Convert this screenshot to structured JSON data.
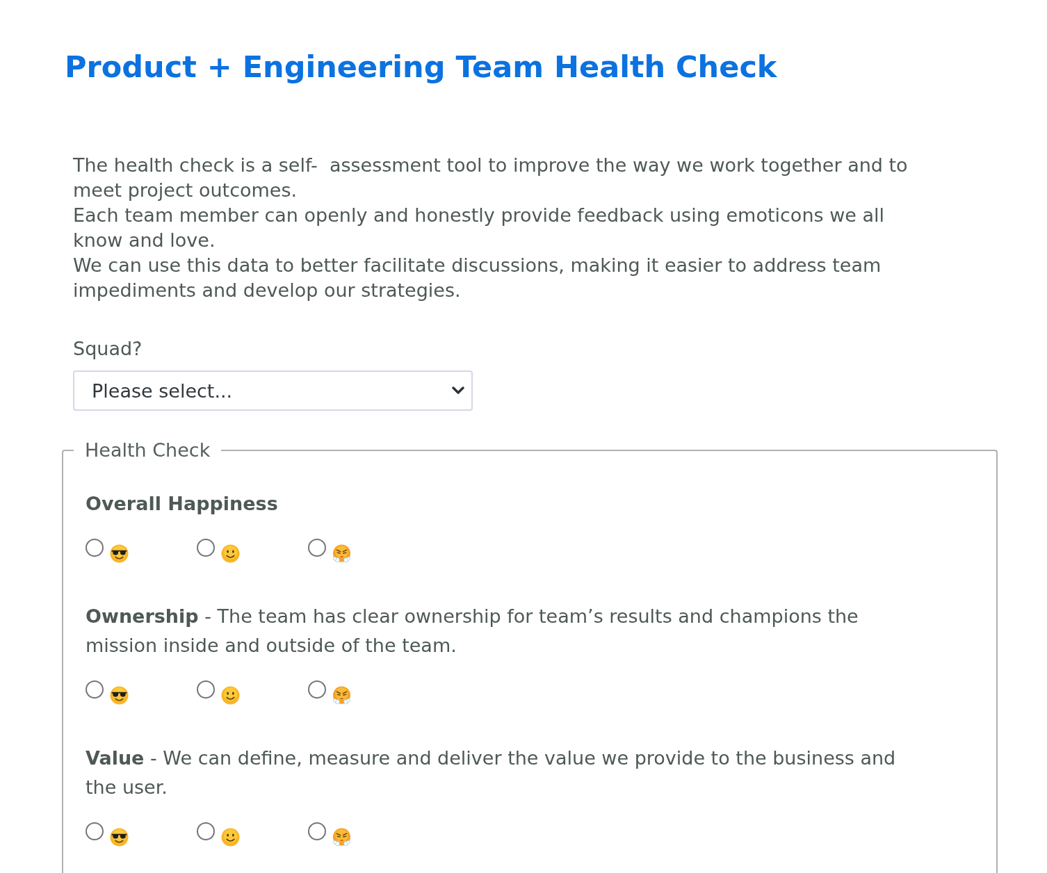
{
  "title": "Product + Engineering Team Health Check",
  "intro": [
    "The health check is a self-  assessment tool to improve the way we work together and to meet project outcomes.",
    "Each team member can openly and honestly provide feedback using emoticons we all know and love.",
    "We can use this data to better facilitate discussions, making it easier to address team impediments and develop our strategies."
  ],
  "squad": {
    "label": "Squad?",
    "placeholder": "Please select..."
  },
  "health_check": {
    "legend": "Health Check",
    "questions": [
      {
        "title": "Overall Happiness",
        "options": [
          {
            "kind": "cool",
            "selected": false
          },
          {
            "kind": "smile",
            "selected": false
          },
          {
            "kind": "steam",
            "selected": false
          }
        ]
      },
      {
        "title": "Ownership",
        "description": "- The team has clear ownership for team’s results and champions the mission inside and outside of the team.",
        "options": [
          {
            "kind": "cool",
            "selected": false
          },
          {
            "kind": "smile",
            "selected": false
          },
          {
            "kind": "steam",
            "selected": false
          }
        ]
      },
      {
        "title": "Value",
        "description": "- We can define, measure and deliver the value we provide to the business and the user.",
        "options": [
          {
            "kind": "cool",
            "selected": false
          },
          {
            "kind": "smile",
            "selected": false
          },
          {
            "kind": "steam",
            "selected": false
          }
        ]
      }
    ]
  }
}
